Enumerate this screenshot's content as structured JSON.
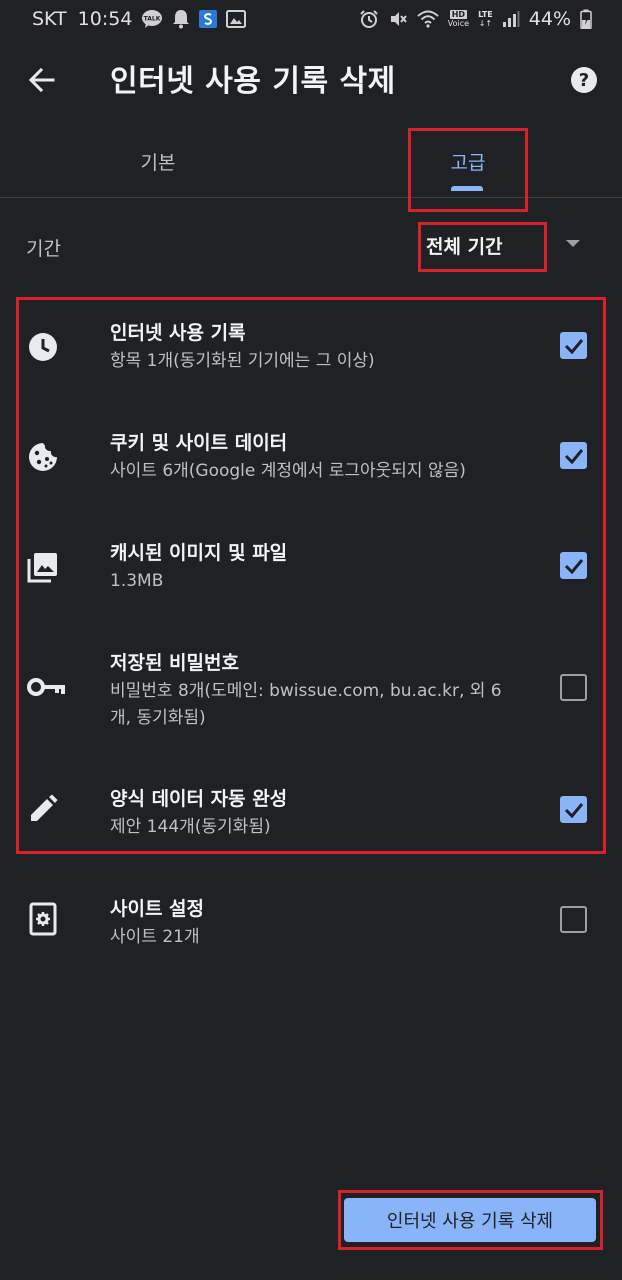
{
  "status_bar": {
    "carrier": "SKT",
    "time": "10:54",
    "talk_badge": "TALK",
    "hd_label": "HD",
    "voice_label": "Voice",
    "lte_label": "LTE",
    "battery": "44%"
  },
  "toolbar": {
    "title": "인터넷 사용 기록 삭제",
    "help_label": "?"
  },
  "tabs": [
    {
      "label": "기본",
      "selected": false
    },
    {
      "label": "고급",
      "selected": true
    }
  ],
  "period": {
    "label": "기간",
    "value": "전체 기간"
  },
  "items": [
    {
      "icon": "clock-icon",
      "title": "인터넷 사용 기록",
      "subtitle": "항목 1개(동기화된 기기에는 그 이상)",
      "checked": true
    },
    {
      "icon": "cookie-icon",
      "title": "쿠키 및 사이트 데이터",
      "subtitle": "사이트 6개(Google 계정에서 로그아웃되지 않음)",
      "checked": true
    },
    {
      "icon": "images-icon",
      "title": "캐시된 이미지 및 파일",
      "subtitle": "1.3MB",
      "checked": true
    },
    {
      "icon": "key-icon",
      "title": "저장된 비밀번호",
      "subtitle": "비밀번호 8개(도메인: bwissue.com, bu.ac.kr, 외 6개, 동기화됨)",
      "checked": false
    },
    {
      "icon": "pencil-icon",
      "title": "양식 데이터 자동 완성",
      "subtitle": "제안 144개(동기화됨)",
      "checked": true
    },
    {
      "icon": "site-settings-icon",
      "title": "사이트 설정",
      "subtitle": "사이트 21개",
      "checked": false
    }
  ],
  "delete_button": {
    "label": "인터넷 사용 기록 삭제"
  },
  "colors": {
    "background": "#202124",
    "accent": "#8ab4f8",
    "highlight": "#d6232b"
  }
}
